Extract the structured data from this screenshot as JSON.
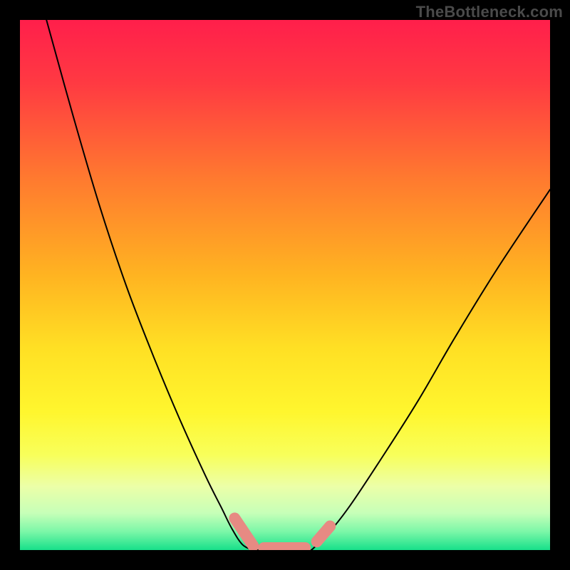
{
  "watermark": "TheBottleneck.com",
  "chart_data": {
    "type": "line",
    "title": "",
    "xlabel": "",
    "ylabel": "",
    "xlim": [
      0,
      100
    ],
    "ylim": [
      0,
      100
    ],
    "grid": false,
    "legend": false,
    "series": [
      {
        "name": "left-arm",
        "type": "curve",
        "x": [
          5,
          10,
          15,
          20,
          25,
          30,
          35,
          38,
          40,
          42,
          44
        ],
        "y": [
          100,
          82,
          65,
          50,
          37,
          25,
          14,
          8,
          4,
          1,
          0
        ]
      },
      {
        "name": "right-arm",
        "type": "curve",
        "x": [
          55,
          58,
          62,
          68,
          75,
          82,
          90,
          100
        ],
        "y": [
          0,
          3,
          8,
          17,
          28,
          40,
          53,
          68
        ]
      },
      {
        "name": "flat-bottom",
        "type": "curve",
        "x": [
          44,
          55
        ],
        "y": [
          0,
          0
        ]
      }
    ],
    "markers": [
      {
        "name": "left-upper-cap",
        "cx": 40.5,
        "cy": 6.0
      },
      {
        "name": "left-lower-cap",
        "cx": 44.0,
        "cy": 0.8
      },
      {
        "name": "flat-left-cap",
        "cx": 46.0,
        "cy": 0.4
      },
      {
        "name": "flat-right-cap",
        "cx": 53.8,
        "cy": 0.4
      },
      {
        "name": "right-lower-cap",
        "cx": 56.0,
        "cy": 1.6
      },
      {
        "name": "right-upper-cap",
        "cx": 58.5,
        "cy": 4.5
      }
    ],
    "marker_color": "#e78a83",
    "curve_color": "#000000",
    "gradient_stops": [
      {
        "offset": 0.0,
        "color": "#ff1f4b"
      },
      {
        "offset": 0.12,
        "color": "#ff3a42"
      },
      {
        "offset": 0.3,
        "color": "#ff7a2f"
      },
      {
        "offset": 0.48,
        "color": "#ffb321"
      },
      {
        "offset": 0.62,
        "color": "#ffe024"
      },
      {
        "offset": 0.74,
        "color": "#fff62e"
      },
      {
        "offset": 0.82,
        "color": "#f8ff5a"
      },
      {
        "offset": 0.88,
        "color": "#ecffa8"
      },
      {
        "offset": 0.93,
        "color": "#c7ffb8"
      },
      {
        "offset": 0.965,
        "color": "#7cf7a8"
      },
      {
        "offset": 1.0,
        "color": "#17e08a"
      }
    ]
  }
}
